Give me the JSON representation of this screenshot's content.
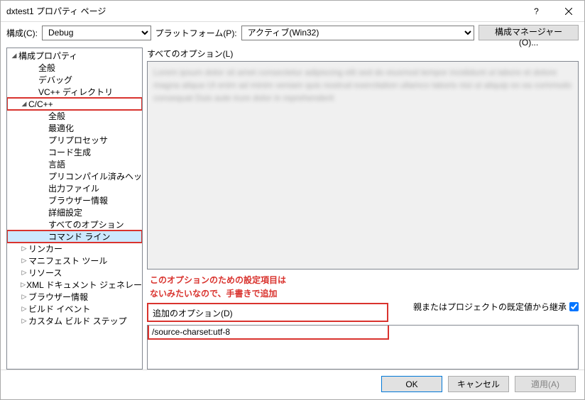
{
  "window": {
    "title": "dxtest1 プロパティ ページ"
  },
  "toolbar": {
    "config_label": "構成(C):",
    "config_value": "Debug",
    "platform_label": "プラットフォーム(P):",
    "platform_value": "アクティブ(Win32)",
    "manager_btn": "構成マネージャー(O)..."
  },
  "tree": [
    {
      "label": "構成プロパティ",
      "depth": 0,
      "arrow": "◢"
    },
    {
      "label": "全般",
      "depth": 2
    },
    {
      "label": "デバッグ",
      "depth": 2
    },
    {
      "label": "VC++ ディレクトリ",
      "depth": 2
    },
    {
      "label": "C/C++",
      "depth": 1,
      "arrow": "◢",
      "highlight": true
    },
    {
      "label": "全般",
      "depth": 3
    },
    {
      "label": "最適化",
      "depth": 3
    },
    {
      "label": "プリプロセッサ",
      "depth": 3
    },
    {
      "label": "コード生成",
      "depth": 3
    },
    {
      "label": "言語",
      "depth": 3
    },
    {
      "label": "プリコンパイル済みヘッ",
      "depth": 3
    },
    {
      "label": "出力ファイル",
      "depth": 3
    },
    {
      "label": "ブラウザー情報",
      "depth": 3
    },
    {
      "label": "詳細設定",
      "depth": 3
    },
    {
      "label": "すべてのオプション",
      "depth": 3
    },
    {
      "label": "コマンド ライン",
      "depth": 3,
      "selected": true,
      "highlight": true
    },
    {
      "label": "リンカー",
      "depth": 1,
      "arrow": "▷"
    },
    {
      "label": "マニフェスト ツール",
      "depth": 1,
      "arrow": "▷"
    },
    {
      "label": "リソース",
      "depth": 1,
      "arrow": "▷"
    },
    {
      "label": "XML ドキュメント ジェネレー",
      "depth": 1,
      "arrow": "▷"
    },
    {
      "label": "ブラウザー情報",
      "depth": 1,
      "arrow": "▷"
    },
    {
      "label": "ビルド イベント",
      "depth": 1,
      "arrow": "▷"
    },
    {
      "label": "カスタム ビルド ステップ",
      "depth": 1,
      "arrow": "▷"
    }
  ],
  "content": {
    "all_options_label": "すべてのオプション(L)",
    "all_options_blur": "Lorem ipsum dolor sit amet consectetur adipiscing elit sed do eiusmod tempor incididunt ut labore et dolore magna aliqua Ut enim ad minim veniam quis nostrud exercitation ullamco laboris nisi ut aliquip ex ea commodo consequat Duis aute irure dolor in reprehenderit",
    "annotation_line1": "このオプションのための設定項目は",
    "annotation_line2": "ないみたいなので、手書きで追加",
    "inherit_label": "親またはプロジェクトの既定値から継承",
    "extra_label": "追加のオプション(D)",
    "extra_value": "/source-charset:utf-8"
  },
  "footer": {
    "ok": "OK",
    "cancel": "キャンセル",
    "apply": "適用(A)"
  }
}
